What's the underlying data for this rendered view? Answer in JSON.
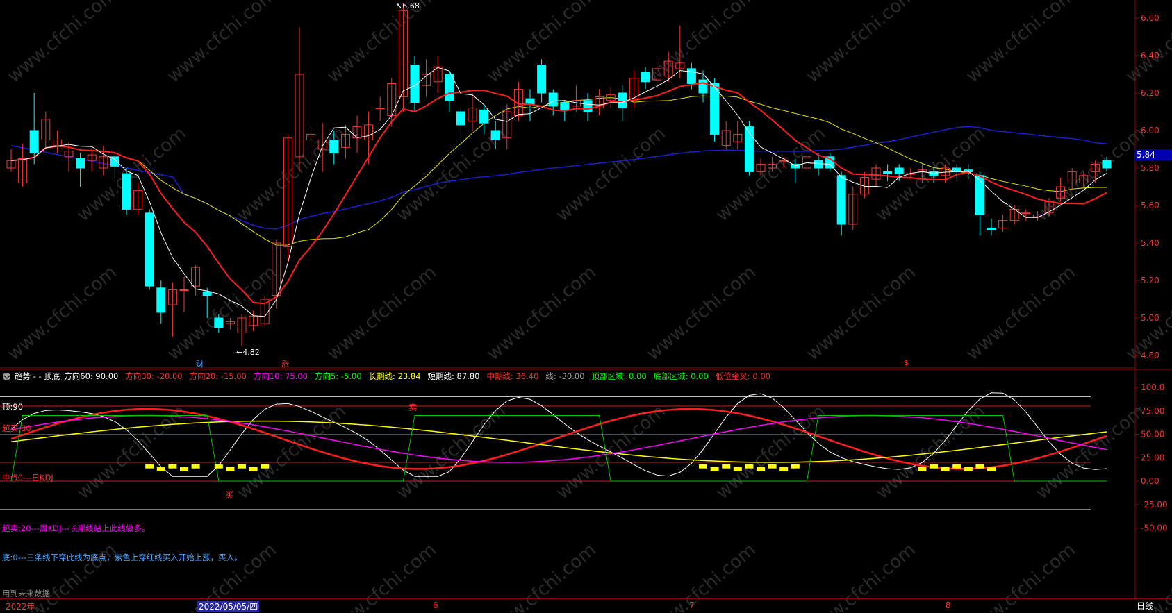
{
  "price_axis": {
    "ticks": [
      "6.60",
      "6.40",
      "6.20",
      "6.00",
      "5.80",
      "5.60",
      "5.40",
      "5.20",
      "5.00",
      "4.80"
    ],
    "current_price": "5.84",
    "current_price_color": "#0000b0"
  },
  "indicator_axis": {
    "ticks": [
      "100.0",
      "75.00",
      "50.00",
      "25.00",
      "0.00",
      "-25.00",
      "-50.00"
    ]
  },
  "price_annotations": {
    "high": "6.68",
    "low": "4.82",
    "marker_cai": "财",
    "marker_zhang": "涨",
    "marker_dollar": "$"
  },
  "indicator_header": {
    "name": "趋势 - - 顶底",
    "items": [
      {
        "label": "方向60: 90.00",
        "color": "#ffffff"
      },
      {
        "label": "方向30: -20.00",
        "color": "#ff3030"
      },
      {
        "label": "方向20: -15.00",
        "color": "#ff3030"
      },
      {
        "label": "方向10: 75.00",
        "color": "#ff00ff"
      },
      {
        "label": "方向5: -5.00",
        "color": "#00ff00"
      },
      {
        "label": "长期线: 23.84",
        "color": "#ffff00"
      },
      {
        "label": "短期线: 87.80",
        "color": "#ffffff"
      },
      {
        "label": "中期线: 36.40",
        "color": "#ff3030"
      },
      {
        "label": "线: -30.00",
        "color": "#a0a0a0"
      },
      {
        "label": "顶部区域: 0.00",
        "color": "#00ff00"
      },
      {
        "label": "底部区域: 0.00",
        "color": "#00ff00"
      },
      {
        "label": "低位金叉: 0.00",
        "color": "#ff3030"
      }
    ]
  },
  "indicator_labels": {
    "top90": "顶:90",
    "overbought80": "超买:80",
    "mid50": "中:50---日KDJ",
    "oversold20": "超卖:20---周KDJ---长期线站上此线做多。",
    "bottom0": "底:0---三条线下穿此线为底点，紫色上穿红线买入开始上涨，买入。",
    "future_data": "用到未来数据",
    "buy_mark": "买",
    "sell_mark": "卖"
  },
  "time_axis": {
    "labels": [
      "2022年",
      "2022/05/05/四",
      "6",
      "7",
      "8"
    ],
    "selected": "2022/05/05/四"
  },
  "period_button": "日线",
  "watermark": "www.cfchi.com",
  "colors": {
    "up": "#ff3232",
    "down": "#00ffff",
    "ma5": "#ffffff",
    "ma10": "#ff1f1f",
    "ma20": "#e6e600",
    "ma60": "#1e1ed2"
  }
}
